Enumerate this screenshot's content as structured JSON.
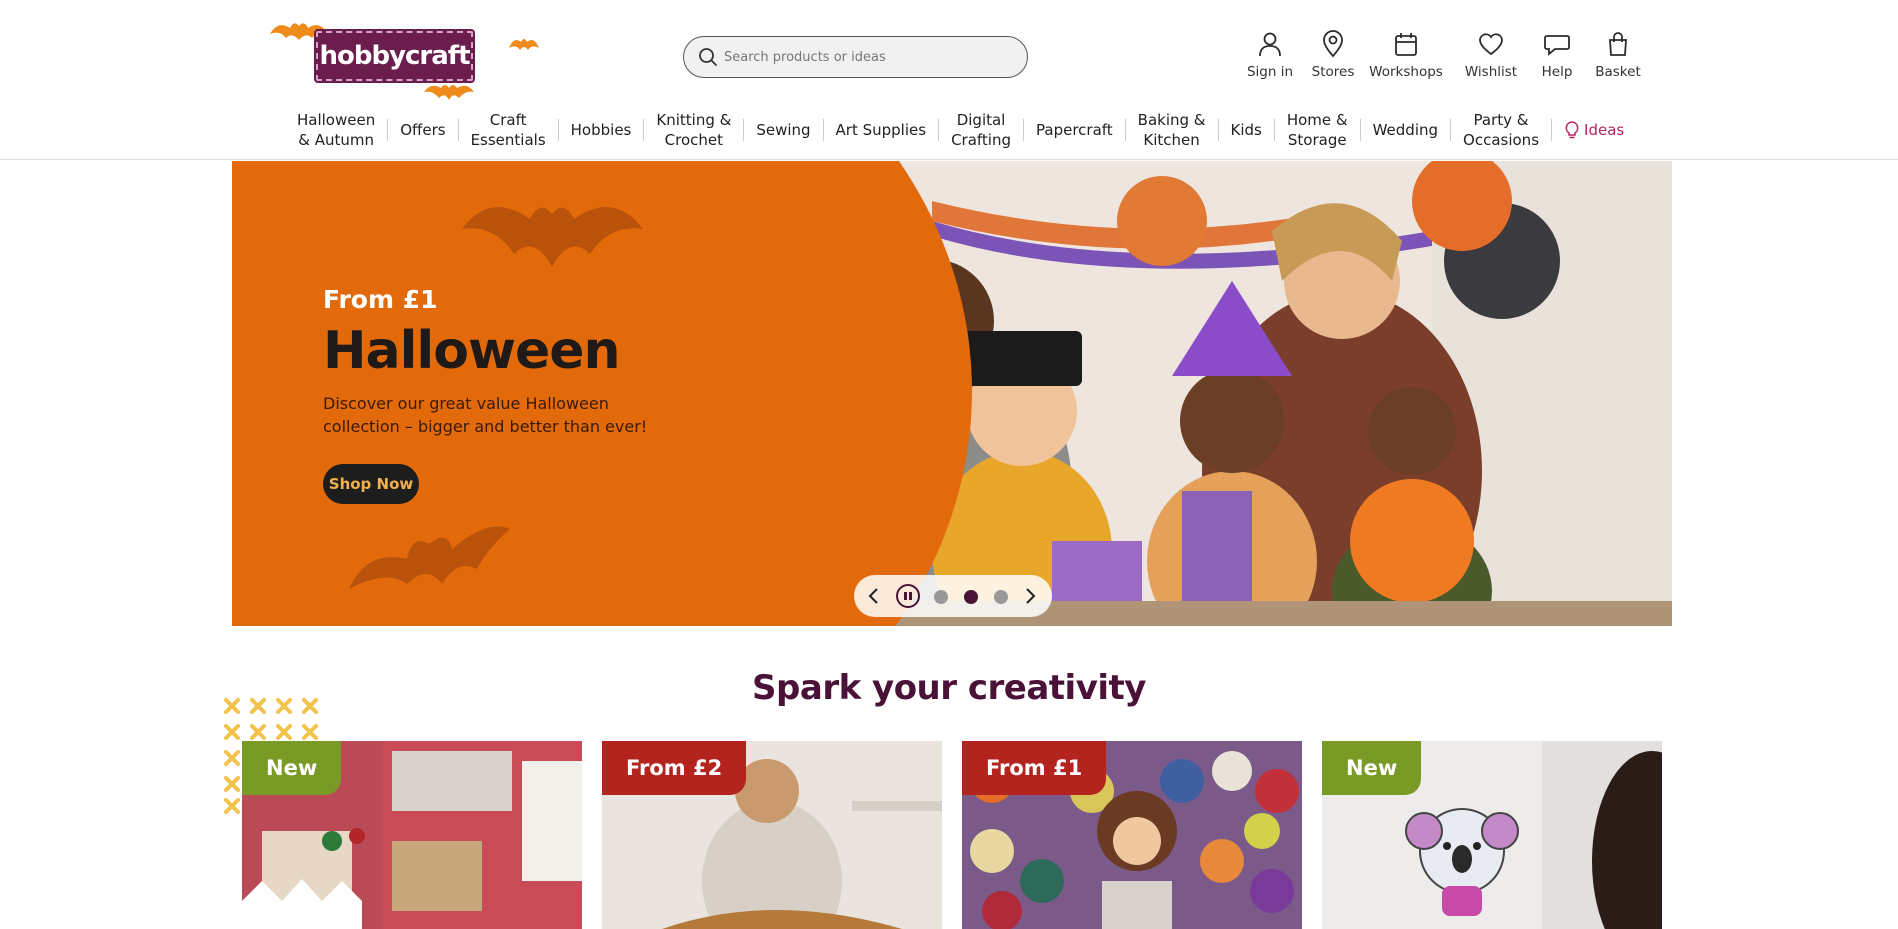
{
  "brand": {
    "logo_text": "hobbycraft"
  },
  "search": {
    "placeholder": "Search products or ideas"
  },
  "utility_nav": [
    {
      "label": "Sign in",
      "icon": "person-icon"
    },
    {
      "label": "Stores",
      "icon": "location-pin-icon"
    },
    {
      "label": "Workshops",
      "icon": "calendar-icon"
    },
    {
      "label": "Wishlist",
      "icon": "heart-icon"
    },
    {
      "label": "Help",
      "icon": "speech-bubble-icon"
    },
    {
      "label": "Basket",
      "icon": "shopping-bag-icon"
    }
  ],
  "main_nav": [
    {
      "line1": "Halloween",
      "line2": "& Autumn"
    },
    {
      "line1": "Offers",
      "line2": ""
    },
    {
      "line1": "Craft",
      "line2": "Essentials"
    },
    {
      "line1": "Hobbies",
      "line2": ""
    },
    {
      "line1": "Knitting &",
      "line2": "Crochet"
    },
    {
      "line1": "Sewing",
      "line2": ""
    },
    {
      "line1": "Art Supplies",
      "line2": ""
    },
    {
      "line1": "Digital",
      "line2": "Crafting"
    },
    {
      "line1": "Papercraft",
      "line2": ""
    },
    {
      "line1": "Baking &",
      "line2": "Kitchen"
    },
    {
      "line1": "Kids",
      "line2": ""
    },
    {
      "line1": "Home &",
      "line2": "Storage"
    },
    {
      "line1": "Wedding",
      "line2": ""
    },
    {
      "line1": "Party &",
      "line2": "Occasions"
    },
    {
      "line1": "Ideas",
      "line2": "",
      "icon": "lightbulb-icon"
    }
  ],
  "hero": {
    "eyebrow": "From £1",
    "title": "Halloween",
    "description": "Discover our great value Halloween collection – bigger and better than ever!",
    "cta": "Shop Now",
    "carousel": {
      "slides": 3,
      "active_slide": 2,
      "paused": true
    }
  },
  "section": {
    "title": "Spark your creativity"
  },
  "cards": [
    {
      "badge": "New",
      "badge_color": "#7a9a26"
    },
    {
      "badge": "From £2",
      "badge_color": "#b4241f"
    },
    {
      "badge": "From £1",
      "badge_color": "#b4241f"
    },
    {
      "badge": "New",
      "badge_color": "#7a9a26"
    }
  ],
  "colors": {
    "brand_purple": "#4a1237",
    "halloween_orange": "#e36a0a",
    "ideas_pink": "#b3245f"
  }
}
